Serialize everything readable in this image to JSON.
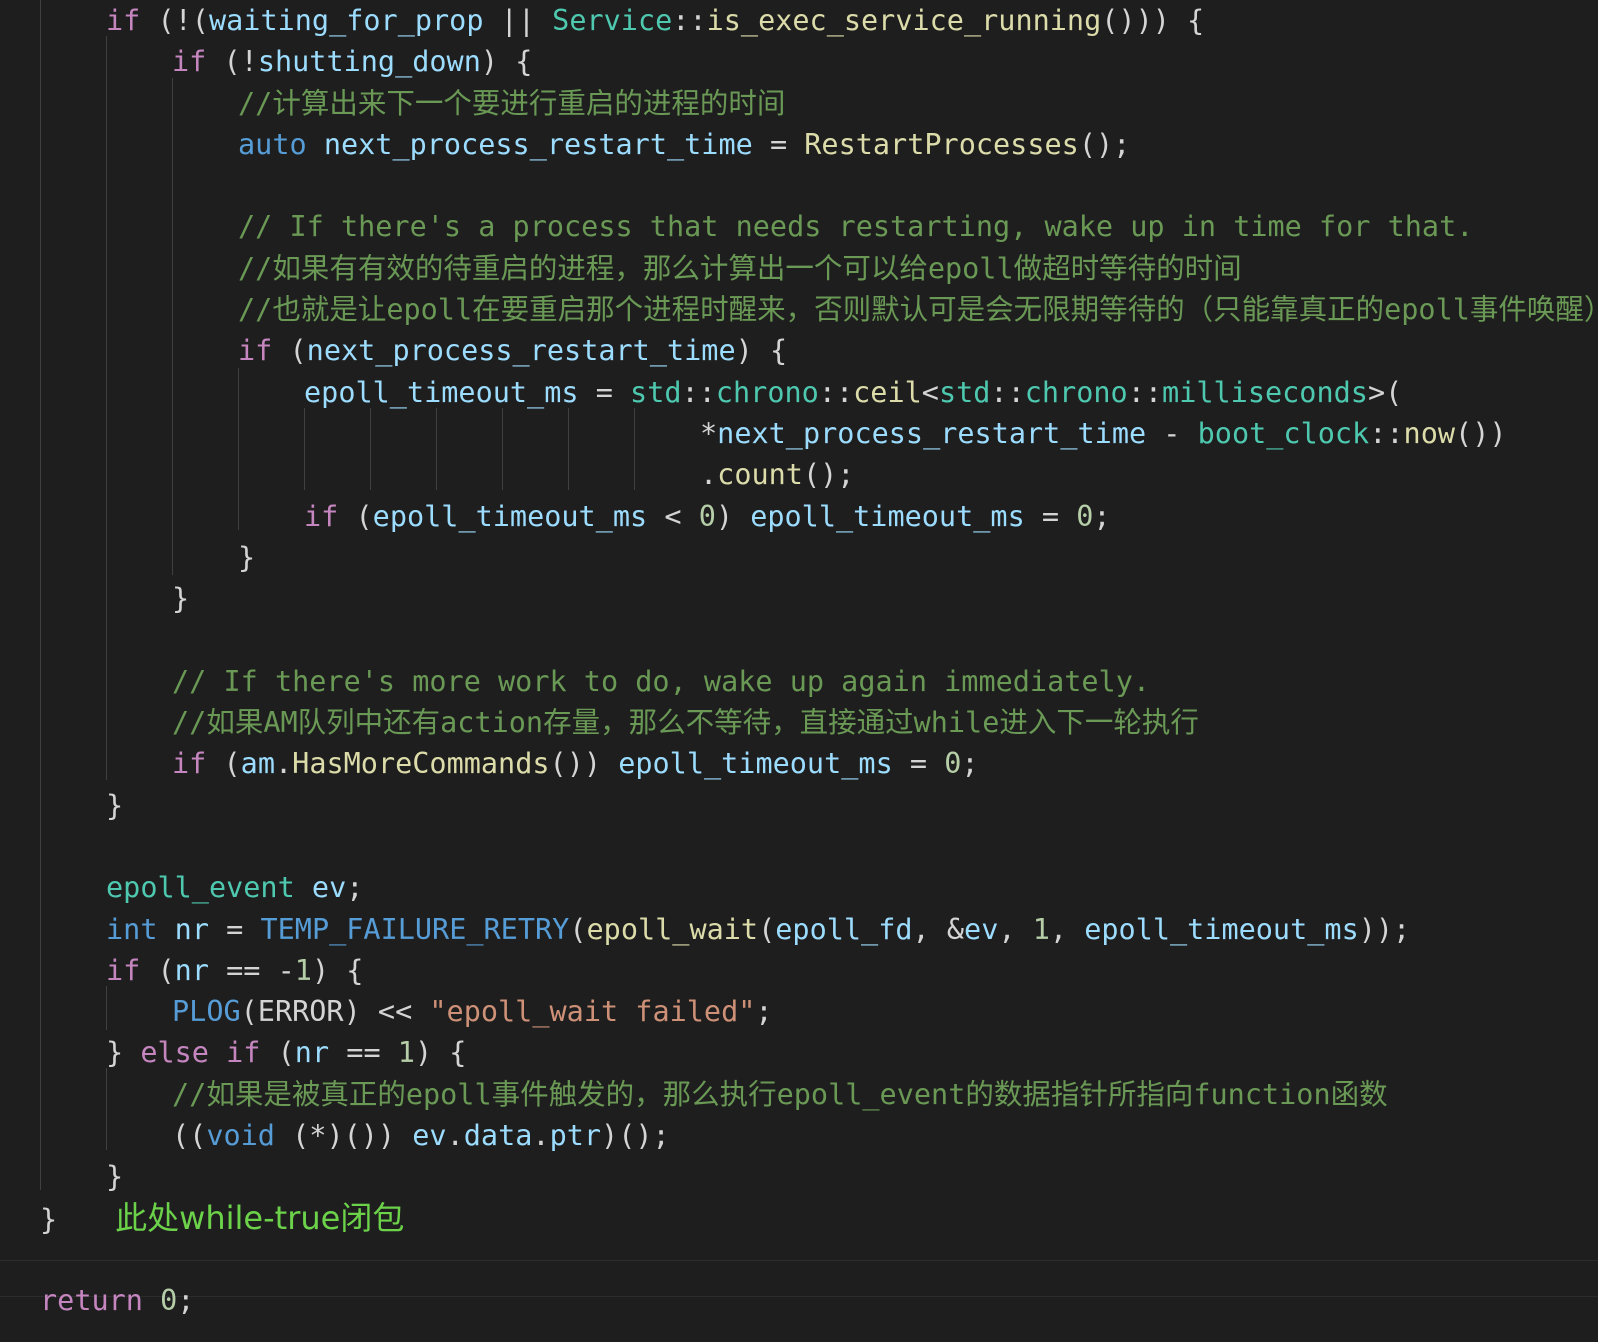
{
  "colors": {
    "background": "#1e1e1e",
    "keyword": "#c586c0",
    "variable": "#9cdcfe",
    "function": "#dcdcaa",
    "type": "#4ec9b0",
    "storage": "#569cd6",
    "comment": "#6a9955",
    "string": "#ce9178",
    "number": "#b5cea8",
    "default": "#d4d4d4",
    "annotation": "#6bd24a"
  },
  "code_lines": [
    {
      "indent": 1,
      "tokens": [
        [
          "if",
          "keyword"
        ],
        [
          " (!(",
          "default"
        ],
        [
          "waiting_for_prop",
          "variable"
        ],
        [
          " || ",
          "default"
        ],
        [
          "Service",
          "type"
        ],
        [
          "::",
          "default"
        ],
        [
          "is_exec_service_running",
          "function"
        ],
        [
          "())) {",
          "default"
        ]
      ]
    },
    {
      "indent": 2,
      "tokens": [
        [
          "if",
          "keyword"
        ],
        [
          " (!",
          "default"
        ],
        [
          "shutting_down",
          "variable"
        ],
        [
          ") {",
          "default"
        ]
      ]
    },
    {
      "indent": 3,
      "tokens": [
        [
          "//计算出来下一个要进行重启的进程的时间",
          "comment"
        ]
      ]
    },
    {
      "indent": 3,
      "tokens": [
        [
          "auto",
          "storage"
        ],
        [
          " ",
          "default"
        ],
        [
          "next_process_restart_time",
          "variable"
        ],
        [
          " = ",
          "default"
        ],
        [
          "RestartProcesses",
          "function"
        ],
        [
          "();",
          "default"
        ]
      ]
    },
    {
      "indent": 0,
      "tokens": []
    },
    {
      "indent": 3,
      "tokens": [
        [
          "// If there's a process that needs restarting, wake up in time for that.",
          "comment"
        ]
      ]
    },
    {
      "indent": 3,
      "tokens": [
        [
          "//如果有有效的待重启的进程，那么计算出一个可以给epoll做超时等待的时间",
          "comment"
        ]
      ]
    },
    {
      "indent": 3,
      "tokens": [
        [
          "//也就是让epoll在要重启那个进程时醒来，否则默认可是会无限期等待的（只能靠真正的epoll事件唤醒）",
          "comment"
        ]
      ]
    },
    {
      "indent": 3,
      "tokens": [
        [
          "if",
          "keyword"
        ],
        [
          " (",
          "default"
        ],
        [
          "next_process_restart_time",
          "variable"
        ],
        [
          ") {",
          "default"
        ]
      ]
    },
    {
      "indent": 4,
      "tokens": [
        [
          "epoll_timeout_ms",
          "variable"
        ],
        [
          " = ",
          "default"
        ],
        [
          "std",
          "type"
        ],
        [
          "::",
          "default"
        ],
        [
          "chrono",
          "type"
        ],
        [
          "::",
          "default"
        ],
        [
          "ceil",
          "function"
        ],
        [
          "<",
          "default"
        ],
        [
          "std",
          "type"
        ],
        [
          "::",
          "default"
        ],
        [
          "chrono",
          "type"
        ],
        [
          "::",
          "default"
        ],
        [
          "milliseconds",
          "type"
        ],
        [
          ">(",
          "default"
        ]
      ]
    },
    {
      "indent": 10,
      "tokens": [
        [
          "*",
          "default"
        ],
        [
          "next_process_restart_time",
          "variable"
        ],
        [
          " - ",
          "default"
        ],
        [
          "boot_clock",
          "type"
        ],
        [
          "::",
          "default"
        ],
        [
          "now",
          "function"
        ],
        [
          "())",
          "default"
        ]
      ]
    },
    {
      "indent": 10,
      "tokens": [
        [
          ".",
          "default"
        ],
        [
          "count",
          "function"
        ],
        [
          "();",
          "default"
        ]
      ]
    },
    {
      "indent": 4,
      "tokens": [
        [
          "if",
          "keyword"
        ],
        [
          " (",
          "default"
        ],
        [
          "epoll_timeout_ms",
          "variable"
        ],
        [
          " < ",
          "default"
        ],
        [
          "0",
          "number"
        ],
        [
          ") ",
          "default"
        ],
        [
          "epoll_timeout_ms",
          "variable"
        ],
        [
          " = ",
          "default"
        ],
        [
          "0",
          "number"
        ],
        [
          ";",
          "default"
        ]
      ]
    },
    {
      "indent": 3,
      "tokens": [
        [
          "}",
          "default"
        ]
      ]
    },
    {
      "indent": 2,
      "tokens": [
        [
          "}",
          "default"
        ]
      ]
    },
    {
      "indent": 0,
      "tokens": []
    },
    {
      "indent": 2,
      "tokens": [
        [
          "// If there's more work to do, wake up again immediately.",
          "comment"
        ]
      ]
    },
    {
      "indent": 2,
      "tokens": [
        [
          "//如果AM队列中还有action存量，那么不等待，直接通过while进入下一轮执行",
          "comment"
        ]
      ]
    },
    {
      "indent": 2,
      "tokens": [
        [
          "if",
          "keyword"
        ],
        [
          " (",
          "default"
        ],
        [
          "am",
          "variable"
        ],
        [
          ".",
          "default"
        ],
        [
          "HasMoreCommands",
          "function"
        ],
        [
          "()) ",
          "default"
        ],
        [
          "epoll_timeout_ms",
          "variable"
        ],
        [
          " = ",
          "default"
        ],
        [
          "0",
          "number"
        ],
        [
          ";",
          "default"
        ]
      ]
    },
    {
      "indent": 1,
      "tokens": [
        [
          "}",
          "default"
        ]
      ]
    },
    {
      "indent": 0,
      "tokens": []
    },
    {
      "indent": 1,
      "tokens": [
        [
          "epoll_event",
          "type"
        ],
        [
          " ",
          "default"
        ],
        [
          "ev",
          "variable"
        ],
        [
          ";",
          "default"
        ]
      ]
    },
    {
      "indent": 1,
      "tokens": [
        [
          "int",
          "storage"
        ],
        [
          " ",
          "default"
        ],
        [
          "nr",
          "variable"
        ],
        [
          " = ",
          "default"
        ],
        [
          "TEMP_FAILURE_RETRY",
          "storage"
        ],
        [
          "(",
          "default"
        ],
        [
          "epoll_wait",
          "function"
        ],
        [
          "(",
          "default"
        ],
        [
          "epoll_fd",
          "variable"
        ],
        [
          ", &",
          "default"
        ],
        [
          "ev",
          "variable"
        ],
        [
          ", ",
          "default"
        ],
        [
          "1",
          "number"
        ],
        [
          ", ",
          "default"
        ],
        [
          "epoll_timeout_ms",
          "variable"
        ],
        [
          "));",
          "default"
        ]
      ]
    },
    {
      "indent": 1,
      "tokens": [
        [
          "if",
          "keyword"
        ],
        [
          " (",
          "default"
        ],
        [
          "nr",
          "variable"
        ],
        [
          " == -",
          "default"
        ],
        [
          "1",
          "number"
        ],
        [
          ") {",
          "default"
        ]
      ]
    },
    {
      "indent": 2,
      "tokens": [
        [
          "PLOG",
          "storage"
        ],
        [
          "(ERROR) << ",
          "default"
        ],
        [
          "\"epoll_wait failed\"",
          "string"
        ],
        [
          ";",
          "default"
        ]
      ]
    },
    {
      "indent": 1,
      "tokens": [
        [
          "} ",
          "default"
        ],
        [
          "else",
          "keyword"
        ],
        [
          " ",
          "default"
        ],
        [
          "if",
          "keyword"
        ],
        [
          " (",
          "default"
        ],
        [
          "nr",
          "variable"
        ],
        [
          " == ",
          "default"
        ],
        [
          "1",
          "number"
        ],
        [
          ") {",
          "default"
        ]
      ]
    },
    {
      "indent": 2,
      "tokens": [
        [
          "//如果是被真正的epoll事件触发的，那么执行epoll_event的数据指针所指向function函数",
          "comment"
        ]
      ]
    },
    {
      "indent": 2,
      "tokens": [
        [
          "((",
          "default"
        ],
        [
          "void",
          "storage"
        ],
        [
          " (*)()) ",
          "default"
        ],
        [
          "ev",
          "variable"
        ],
        [
          ".",
          "default"
        ],
        [
          "data",
          "variable"
        ],
        [
          ".",
          "default"
        ],
        [
          "ptr",
          "variable"
        ],
        [
          ")();",
          "default"
        ]
      ]
    },
    {
      "indent": 1,
      "tokens": [
        [
          "}",
          "default"
        ]
      ]
    },
    {
      "indent": 0,
      "tokens": [
        [
          "}",
          "default"
        ]
      ],
      "note": "此处while-true闭包"
    },
    {
      "indent": 0,
      "tokens": []
    },
    {
      "indent": 0,
      "tokens": [
        [
          "return",
          "keyword"
        ],
        [
          " ",
          "default"
        ],
        [
          "0",
          "number"
        ],
        [
          ";",
          "default"
        ]
      ]
    }
  ]
}
